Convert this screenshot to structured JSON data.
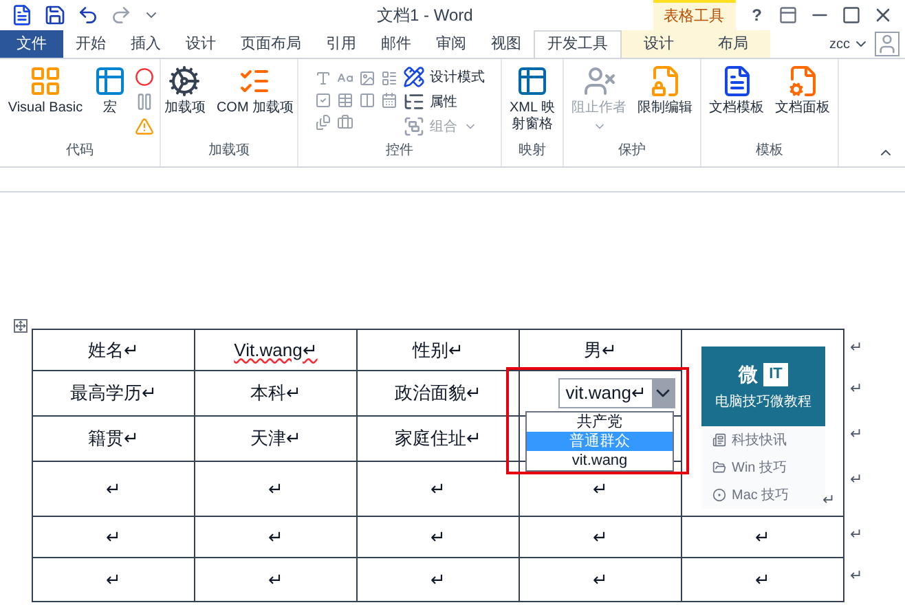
{
  "window": {
    "title": "文档1 - Word",
    "context_label": "表格工具",
    "help": "?"
  },
  "tabs": [
    {
      "label": "文件",
      "kind": "file",
      "selected": false
    },
    {
      "label": "开始",
      "kind": "normal",
      "selected": false
    },
    {
      "label": "插入",
      "kind": "normal",
      "selected": false
    },
    {
      "label": "设计",
      "kind": "normal",
      "selected": false
    },
    {
      "label": "页面布局",
      "kind": "normal",
      "selected": false
    },
    {
      "label": "引用",
      "kind": "normal",
      "selected": false
    },
    {
      "label": "邮件",
      "kind": "normal",
      "selected": false
    },
    {
      "label": "审阅",
      "kind": "normal",
      "selected": false
    },
    {
      "label": "视图",
      "kind": "normal",
      "selected": false
    },
    {
      "label": "开发工具",
      "kind": "normal",
      "selected": true
    },
    {
      "label": "设计",
      "kind": "context",
      "selected": false
    },
    {
      "label": "布局",
      "kind": "context",
      "selected": false
    }
  ],
  "account": {
    "name": "zcc"
  },
  "ribbon": {
    "groups": [
      {
        "label": "代码",
        "buttons": [
          {
            "label": "Visual Basic",
            "kind": "large",
            "disabled": false
          },
          {
            "label": "宏",
            "kind": "large",
            "disabled": false
          }
        ]
      },
      {
        "label": "加载项",
        "buttons": [
          {
            "label": "加载项",
            "kind": "large",
            "disabled": false
          },
          {
            "label": "COM 加载项",
            "kind": "large",
            "disabled": false
          }
        ]
      },
      {
        "label": "控件",
        "buttons": [
          {
            "label": "设计模式",
            "kind": "small",
            "disabled": false
          },
          {
            "label": "属性",
            "kind": "small",
            "disabled": false
          },
          {
            "label": "组合",
            "kind": "small",
            "disabled": true
          }
        ]
      },
      {
        "label": "映射",
        "buttons": [
          {
            "label": "XML 映射窗格",
            "kind": "large",
            "disabled": false
          }
        ]
      },
      {
        "label": "保护",
        "buttons": [
          {
            "label": "阻止作者",
            "kind": "large",
            "disabled": true
          },
          {
            "label": "限制编辑",
            "kind": "large",
            "disabled": false
          }
        ]
      },
      {
        "label": "模板",
        "buttons": [
          {
            "label": "文档模板",
            "kind": "large",
            "disabled": false
          },
          {
            "label": "文档面板",
            "kind": "large",
            "disabled": false
          }
        ]
      }
    ]
  },
  "table": {
    "rows": [
      {
        "cells": [
          {
            "kind": "text",
            "text": "姓名↵"
          },
          {
            "kind": "text",
            "text": "Vit.wang↵",
            "misspelled": true
          },
          {
            "kind": "text",
            "text": "性别↵"
          },
          {
            "kind": "text",
            "text": "男↵"
          }
        ],
        "end_mark": "↵"
      },
      {
        "cells": [
          {
            "kind": "text",
            "text": "最高学历↵"
          },
          {
            "kind": "text",
            "text": "本科↵"
          },
          {
            "kind": "text",
            "text": "政治面貌↵"
          },
          {
            "kind": "dropdown",
            "value": "vit.wang↵",
            "expanded": true,
            "options": [
              {
                "label": "共产党",
                "selected": false
              },
              {
                "label": "普通群众",
                "selected": true
              },
              {
                "label": "vit.wang",
                "selected": false
              }
            ]
          }
        ],
        "end_mark": "↵"
      },
      {
        "cells": [
          {
            "kind": "text",
            "text": "籍贯↵"
          },
          {
            "kind": "text",
            "text": "天津↵"
          },
          {
            "kind": "text",
            "text": "家庭住址↵"
          },
          {
            "kind": "covered"
          }
        ],
        "end_mark": "↵"
      },
      {
        "cells": [
          {
            "kind": "text",
            "text": "↵"
          },
          {
            "kind": "text",
            "text": "↵"
          },
          {
            "kind": "text",
            "text": "↵"
          },
          {
            "kind": "text",
            "text": "↵"
          }
        ],
        "end_mark": "↵"
      },
      {
        "cells": [
          {
            "kind": "text",
            "text": "↵"
          },
          {
            "kind": "text",
            "text": "↵"
          },
          {
            "kind": "text",
            "text": "↵"
          },
          {
            "kind": "text",
            "text": "↵"
          },
          {
            "kind": "text",
            "text": "↵"
          }
        ],
        "end_mark": "↵"
      },
      {
        "cells": [
          {
            "kind": "text",
            "text": "↵"
          },
          {
            "kind": "text",
            "text": "↵"
          },
          {
            "kind": "text",
            "text": "↵"
          },
          {
            "kind": "text",
            "text": "↵"
          },
          {
            "kind": "text",
            "text": "↵"
          }
        ],
        "end_mark": "↵"
      }
    ],
    "side_card": {
      "logo": "微",
      "logo_badge": "IT",
      "subtitle": "电脑技巧微教程",
      "links": [
        "科技快讯",
        "Win 技巧",
        "Mac 技巧"
      ],
      "end_mark": "↵"
    }
  }
}
